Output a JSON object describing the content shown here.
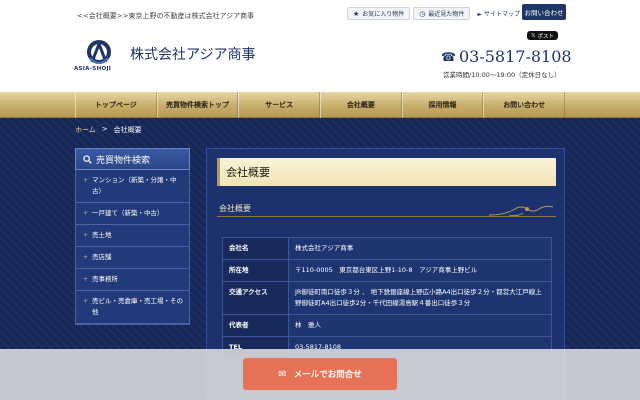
{
  "header": {
    "tagline": "<<会社概要>>東京上野の不動産は株式会社アジア商事",
    "favorites_label": "お気に入り物件",
    "recent_label": "最近見た物件",
    "sitemap_label": "サイトマップ",
    "contact_label": "お問い合わせ",
    "xpost_label": "ポスト",
    "logo_text": "ASIA-SHOJI",
    "company_name": "株式会社アジア商事",
    "phone": "03-5817-8108",
    "hours": "営業時間/10:00〜19:00（定休日なし）"
  },
  "nav": {
    "items": [
      {
        "label": "トップページ"
      },
      {
        "label": "売買物件検索トップ"
      },
      {
        "label": "サービス"
      },
      {
        "label": "会社概要"
      },
      {
        "label": "採用情報"
      },
      {
        "label": "お問い合わせ"
      }
    ]
  },
  "breadcrumb": {
    "home": "ホーム",
    "sep": ">",
    "current": "会社概要"
  },
  "sidebar": {
    "title": "売買物件検索",
    "items": [
      {
        "label": "マンション（新築・分譲・中古）"
      },
      {
        "label": "一戸建て（新築・中古）"
      },
      {
        "label": "売土地"
      },
      {
        "label": "売店舗"
      },
      {
        "label": "売事務所"
      },
      {
        "label": "売ビル・売倉庫・売工場・その他"
      }
    ]
  },
  "content": {
    "title": "会社概要",
    "subtitle": "会社概要",
    "rows": [
      {
        "label": "会社名",
        "value": "株式会社アジア商事"
      },
      {
        "label": "所在地",
        "value": "〒110-0005　東京都台東区上野1-10-8　アジア商事上野ビル"
      },
      {
        "label": "交通アクセス",
        "value": "JR御徒町南口徒歩３分 、 地下鉄銀座線上野広小路A4出口徒歩２分・都営大江戸線上野御徒町A4出口徒歩2分・千代田線湯島駅４番出口徒歩３分"
      },
      {
        "label": "代表者",
        "value": "林　雅人"
      },
      {
        "label": "TEL",
        "value": "03-5817-8108"
      }
    ]
  },
  "cta": {
    "label": "メールでお問合せ"
  },
  "colors": {
    "navy": "#1f3566",
    "gold": "#c7ad6b",
    "cta": "#e67357"
  }
}
